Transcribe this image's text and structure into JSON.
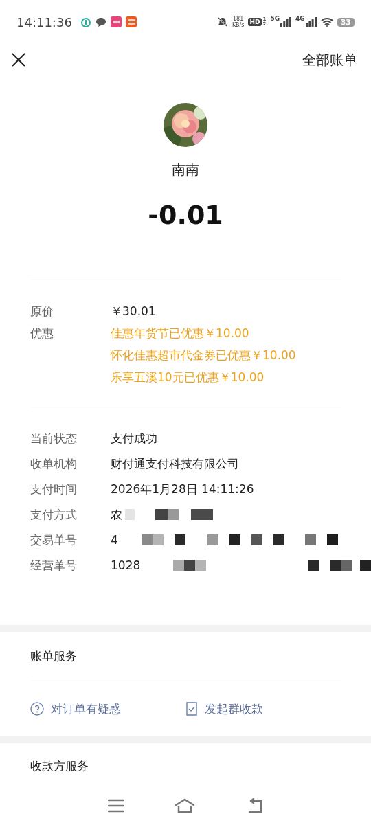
{
  "status_bar": {
    "time": "14:11:36",
    "speed": "181",
    "speed_unit": "KB/s",
    "hd": "HD",
    "hd_sub": "1",
    "hd_sub2": "2",
    "net1": "5G",
    "net2": "4G",
    "battery": "33"
  },
  "header": {
    "action": "全部账单"
  },
  "payee": {
    "name": "南南"
  },
  "amount": "-0.01",
  "price_rows": [
    {
      "label": "原价",
      "values": [
        "￥30.01"
      ],
      "highlight": false
    },
    {
      "label": "优惠",
      "values": [
        "佳惠年货节已优惠￥10.00",
        "怀化佳惠超市代金券已优惠￥10.00",
        "乐享五溪10元已优惠￥10.00"
      ],
      "highlight": true
    }
  ],
  "detail_rows": [
    {
      "label": "当前状态",
      "value": "支付成功",
      "redacted": false
    },
    {
      "label": "收单机构",
      "value": "财付通支付科技有限公司",
      "redacted": false
    },
    {
      "label": "支付时间",
      "value": "2026年1月28日 14:11:26",
      "redacted": false
    },
    {
      "label": "支付方式",
      "value": "农",
      "redacted": true
    },
    {
      "label": "交易单号",
      "value": "4",
      "redacted": true
    },
    {
      "label": "经营单号",
      "value": "1028",
      "redacted": true
    }
  ],
  "bill_service": {
    "title": "账单服务",
    "actions": [
      {
        "label": "对订单有疑惑",
        "kind": "question"
      },
      {
        "label": "发起群收款",
        "kind": "group"
      }
    ]
  },
  "payee_service": {
    "title": "收款方服务"
  }
}
